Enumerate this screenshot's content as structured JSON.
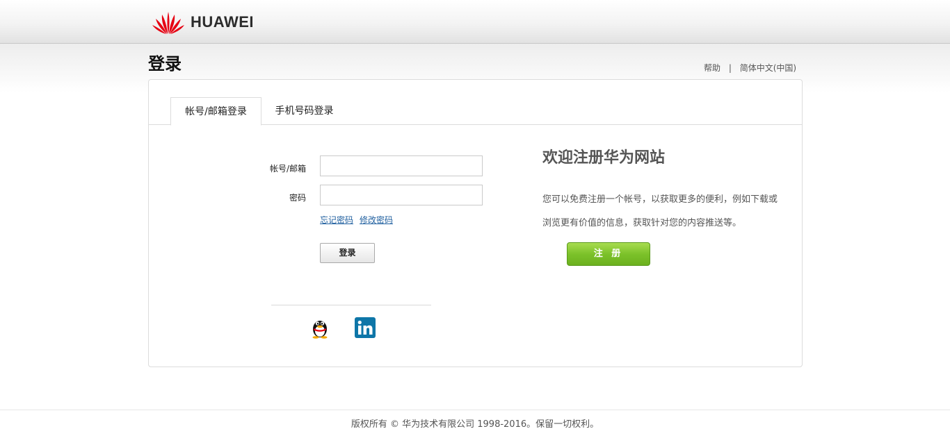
{
  "header": {
    "brand_name": "HUAWEI",
    "logo_icon": "huawei-petal-logo"
  },
  "page": {
    "title": "登录"
  },
  "top_links": {
    "help": "帮助",
    "separator": "|",
    "language": "简体中文(中国)"
  },
  "tabs": [
    {
      "label": "帐号/邮箱登录",
      "active": true
    },
    {
      "label": "手机号码登录",
      "active": false
    }
  ],
  "login_form": {
    "account_label": "帐号/邮箱",
    "account_value": "",
    "password_label": "密码",
    "password_value": "",
    "forgot_password": "忘记密码",
    "change_password": "修改密码",
    "submit_label": "登录"
  },
  "social_login": [
    {
      "icon": "qq-penguin-icon"
    },
    {
      "icon": "linkedin-icon"
    }
  ],
  "welcome": {
    "title": "欢迎注册华为网站",
    "line1": "您可以免费注册一个帐号，以获取更多的便利，例如下载或",
    "line2": "浏览更有价值的信息，获取针对您的内容推送等。",
    "register_label": "注 册"
  },
  "footer": {
    "copyright": "版权所有 © 华为技术有限公司 1998-2016。保留一切权利。"
  },
  "colors": {
    "brand_red": "#e60012",
    "link": "#1f5f9f",
    "register_green": "#7cc22a",
    "linkedin": "#0e76a8"
  }
}
